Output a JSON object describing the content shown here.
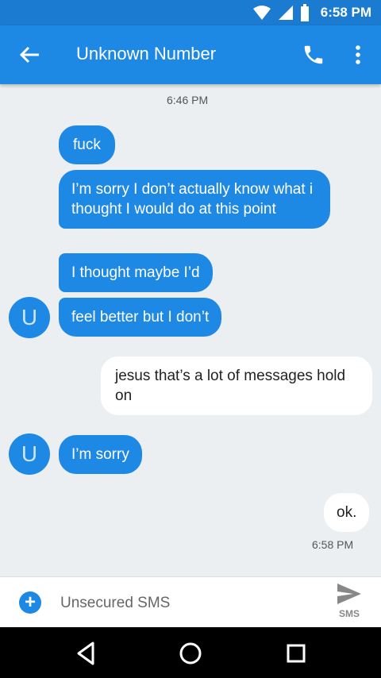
{
  "status_bar": {
    "time": "6:58 PM"
  },
  "app_bar": {
    "title": "Unknown Number"
  },
  "conversation": {
    "timestamp_top": "6:46 PM",
    "avatar_letter": "U",
    "messages": [
      {
        "text": "fuck",
        "direction": "incoming"
      },
      {
        "text": "I’m sorry I don’t actually know what i thought I would do at this point",
        "direction": "incoming"
      },
      {
        "text": "I thought maybe I’d",
        "direction": "incoming"
      },
      {
        "text": "feel better but I don’t",
        "direction": "incoming"
      },
      {
        "text": "jesus that’s a lot of messages hold on",
        "direction": "outgoing"
      },
      {
        "text": "I’m sorry",
        "direction": "incoming"
      },
      {
        "text": "ok.",
        "direction": "outgoing"
      }
    ],
    "timestamp_bottom": "6:58 PM"
  },
  "compose": {
    "placeholder": "Unsecured SMS",
    "send_label": "SMS"
  },
  "colors": {
    "primary": "#1E88E5",
    "status_bar": "#1A7BD0",
    "background": "#ECEFF1"
  }
}
